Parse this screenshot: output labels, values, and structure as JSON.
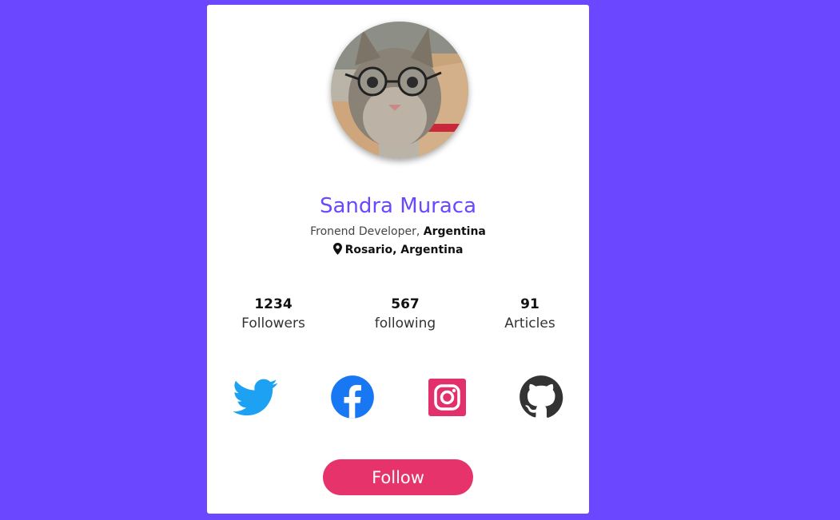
{
  "profile": {
    "name": "Sandra Muraca",
    "role_prefix": "Fronend Developer,",
    "role_country": "Argentina",
    "location": "Rosario, Argentina"
  },
  "stats": [
    {
      "value": "1234",
      "label": "Followers"
    },
    {
      "value": "567",
      "label": "following"
    },
    {
      "value": "91",
      "label": "Articles"
    }
  ],
  "social": [
    {
      "icon": "twitter-icon",
      "color": "#1da1f2"
    },
    {
      "icon": "facebook-icon",
      "color": "#1877f2"
    },
    {
      "icon": "instagram-icon",
      "color": "#e1306c"
    },
    {
      "icon": "github-icon",
      "color": "#333333"
    }
  ],
  "actions": {
    "follow_label": "Follow"
  },
  "colors": {
    "background": "#6b48ff",
    "name": "#6b48ff",
    "follow_button": "#e6336b"
  }
}
